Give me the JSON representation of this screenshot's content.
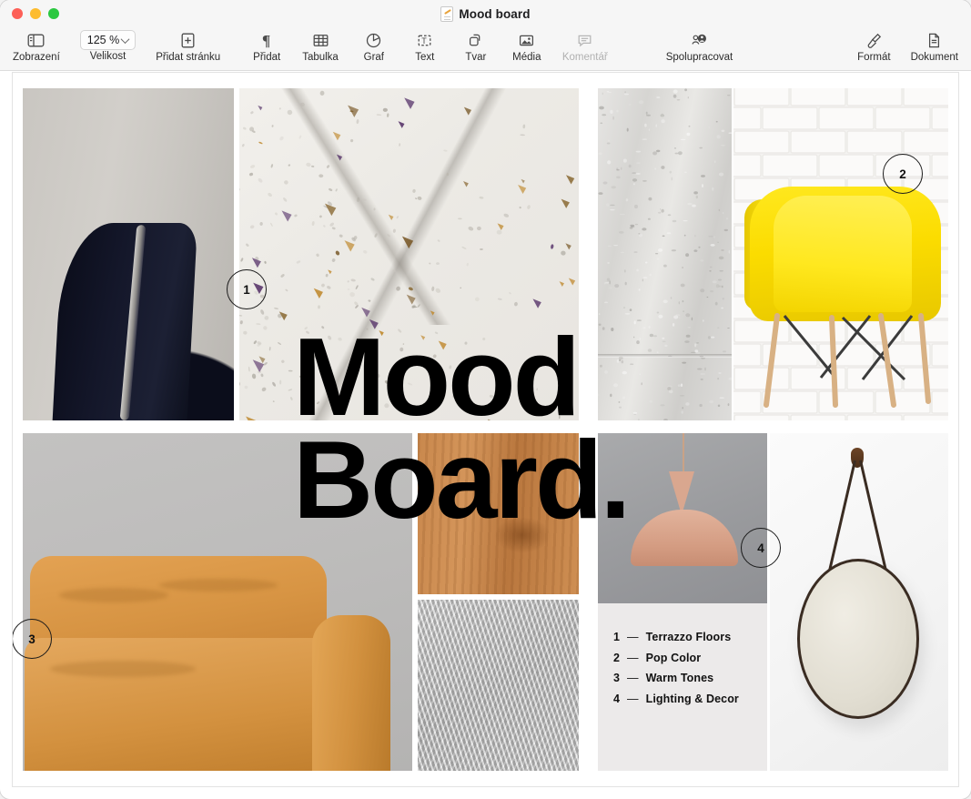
{
  "window": {
    "title": "Mood board",
    "doc_icon": "pages-document-icon",
    "traffic_lights": [
      {
        "name": "close",
        "color": "#fd5f57"
      },
      {
        "name": "minimize",
        "color": "#fdbc2e"
      },
      {
        "name": "zoom",
        "color": "#2bc840"
      }
    ]
  },
  "toolbar": {
    "items": [
      {
        "label": "Zobrazení",
        "icon": "view-sidebar-icon",
        "disabled": false
      },
      {
        "label": "Velikost",
        "icon": "zoom-percent-icon",
        "disabled": false
      },
      {
        "label": "Přidat stránku",
        "icon": "add-page-icon",
        "disabled": false
      },
      {
        "label": "Přidat",
        "icon": "paragraph-icon",
        "disabled": false
      },
      {
        "label": "Tabulka",
        "icon": "table-icon",
        "disabled": false
      },
      {
        "label": "Graf",
        "icon": "chart-icon",
        "disabled": false
      },
      {
        "label": "Text",
        "icon": "text-box-icon",
        "disabled": false
      },
      {
        "label": "Tvar",
        "icon": "shape-icon",
        "disabled": false
      },
      {
        "label": "Média",
        "icon": "media-image-icon",
        "disabled": false
      },
      {
        "label": "Komentář",
        "icon": "comment-icon",
        "disabled": true
      },
      {
        "label": "Spolupracovat",
        "icon": "collaborate-icon",
        "disabled": false
      },
      {
        "label": "Formát",
        "icon": "format-brush-icon",
        "disabled": false
      },
      {
        "label": "Dokument",
        "icon": "document-icon",
        "disabled": false
      }
    ],
    "zoom": {
      "value": "125 %",
      "chevron": "chevron-down-icon"
    }
  },
  "document": {
    "heading_line1": "Mood",
    "heading_line2": "Board.",
    "badges": [
      {
        "number": "1",
        "target": "terrazzo-image"
      },
      {
        "number": "2",
        "target": "yellow-chair-image"
      },
      {
        "number": "3",
        "target": "tan-sofa-image"
      },
      {
        "number": "4",
        "target": "pendant-lamp-image"
      }
    ],
    "legend": [
      {
        "num": "1",
        "dash": "—",
        "label": "Terrazzo Floors"
      },
      {
        "num": "2",
        "dash": "—",
        "label": "Pop Color"
      },
      {
        "num": "3",
        "dash": "—",
        "label": "Warm Tones"
      },
      {
        "num": "4",
        "dash": "—",
        "label": "Lighting & Decor"
      }
    ],
    "images": [
      {
        "name": "dark-chair-grey-wall"
      },
      {
        "name": "terrazzo-slab"
      },
      {
        "name": "concrete-wall-strip"
      },
      {
        "name": "yellow-chair-white-brick"
      },
      {
        "name": "tan-leather-sofa-grey-wall"
      },
      {
        "name": "wood-grain"
      },
      {
        "name": "grey-fur-rug"
      },
      {
        "name": "pink-pendant-lamp"
      },
      {
        "name": "round-strap-mirror"
      }
    ]
  },
  "colors": {
    "accent_yellow": "#ffe81f",
    "tan": "#d3913f",
    "pink": "#d9a78f",
    "legend_bg": "#eceaea",
    "text": "#111111"
  }
}
